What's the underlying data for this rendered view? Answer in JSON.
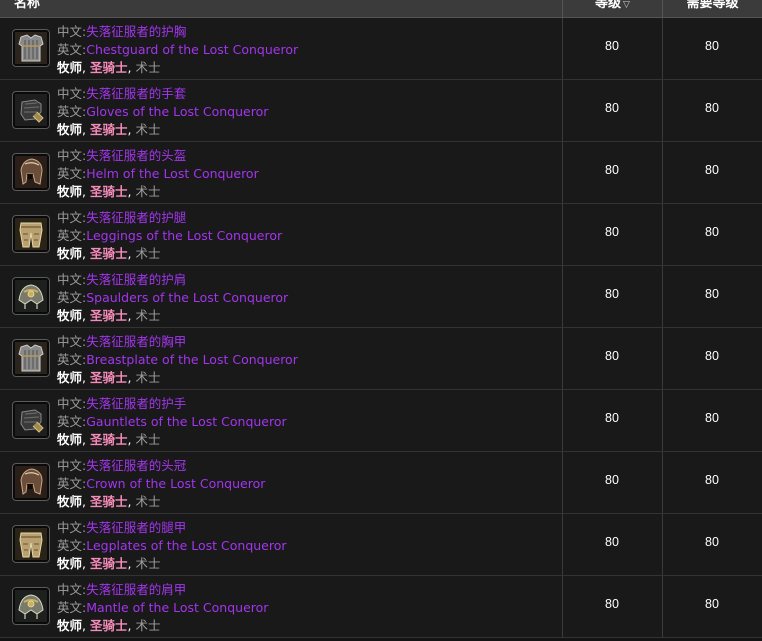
{
  "header": {
    "name": "名称",
    "level": "等级",
    "level_sort_icon": "chevron-down-icon",
    "required_level": "需要等级"
  },
  "colors": {
    "epic_item": "#a335ee",
    "priest": "#ffffff",
    "paladin": "#f58cba",
    "warlock": "#9d9d9d"
  },
  "rows": [
    {
      "icon": "chest-armor-icon",
      "cn_label": "中文:",
      "cn_name": "失落征服者的护胸",
      "en_label": "英文:",
      "en_name": "Chestguard of the Lost Conqueror",
      "class1": "牧师",
      "class2": "圣骑士",
      "class3": "术士",
      "level": "80",
      "req_level": "80"
    },
    {
      "icon": "gloves-icon",
      "cn_label": "中文:",
      "cn_name": "失落征服者的手套",
      "en_label": "英文:",
      "en_name": "Gloves of the Lost Conqueror",
      "class1": "牧师",
      "class2": "圣骑士",
      "class3": "术士",
      "level": "80",
      "req_level": "80"
    },
    {
      "icon": "helm-icon",
      "cn_label": "中文:",
      "cn_name": "失落征服者的头盔",
      "en_label": "英文:",
      "en_name": "Helm of the Lost Conqueror",
      "class1": "牧师",
      "class2": "圣骑士",
      "class3": "术士",
      "level": "80",
      "req_level": "80"
    },
    {
      "icon": "leggings-icon",
      "cn_label": "中文:",
      "cn_name": "失落征服者的护腿",
      "en_label": "英文:",
      "en_name": "Leggings of the Lost Conqueror",
      "class1": "牧师",
      "class2": "圣骑士",
      "class3": "术士",
      "level": "80",
      "req_level": "80"
    },
    {
      "icon": "shoulders-icon",
      "cn_label": "中文:",
      "cn_name": "失落征服者的护肩",
      "en_label": "英文:",
      "en_name": "Spaulders of the Lost Conqueror",
      "class1": "牧师",
      "class2": "圣骑士",
      "class3": "术士",
      "level": "80",
      "req_level": "80"
    },
    {
      "icon": "chest-armor-icon",
      "cn_label": "中文:",
      "cn_name": "失落征服者的胸甲",
      "en_label": "英文:",
      "en_name": "Breastplate of the Lost Conqueror",
      "class1": "牧师",
      "class2": "圣骑士",
      "class3": "术士",
      "level": "80",
      "req_level": "80"
    },
    {
      "icon": "gloves-icon",
      "cn_label": "中文:",
      "cn_name": "失落征服者的护手",
      "en_label": "英文:",
      "en_name": "Gauntlets of the Lost Conqueror",
      "class1": "牧师",
      "class2": "圣骑士",
      "class3": "术士",
      "level": "80",
      "req_level": "80"
    },
    {
      "icon": "helm-icon",
      "cn_label": "中文:",
      "cn_name": "失落征服者的头冠",
      "en_label": "英文:",
      "en_name": "Crown of the Lost Conqueror",
      "class1": "牧师",
      "class2": "圣骑士",
      "class3": "术士",
      "level": "80",
      "req_level": "80"
    },
    {
      "icon": "leggings-icon",
      "cn_label": "中文:",
      "cn_name": "失落征服者的腿甲",
      "en_label": "英文:",
      "en_name": "Legplates of the Lost Conqueror",
      "class1": "牧师",
      "class2": "圣骑士",
      "class3": "术士",
      "level": "80",
      "req_level": "80"
    },
    {
      "icon": "shoulders-icon",
      "cn_label": "中文:",
      "cn_name": "失落征服者的肩甲",
      "en_label": "英文:",
      "en_name": "Mantle of the Lost Conqueror",
      "class1": "牧师",
      "class2": "圣骑士",
      "class3": "术士",
      "level": "80",
      "req_level": "80"
    }
  ]
}
